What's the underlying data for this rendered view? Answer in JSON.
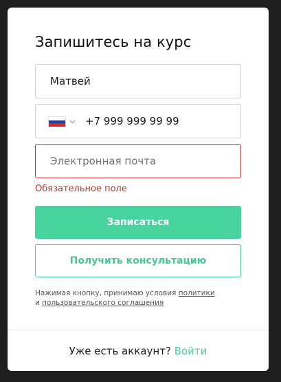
{
  "form": {
    "title": "Запишитесь на курс",
    "name_value": "Матвей",
    "phone": {
      "country_flag": "russia-flag",
      "value": "+7 999 999 99 99"
    },
    "email_placeholder": "Электронная почта",
    "email_error": "Обязательное поле",
    "submit_label": "Записаться",
    "consult_label": "Получить консультацию",
    "consent": {
      "text_before": "Нажимая кнопку, принимаю условия ",
      "policy_link": "политики",
      "conjunction": "и ",
      "agreement_link": "пользовательского соглашения"
    }
  },
  "footer": {
    "question": "Уже есть аккаунт? ",
    "login_link": "Войти"
  },
  "colors": {
    "accent": "#47d39d",
    "error": "#c0392b",
    "card_bg": "#ffffff",
    "page_bg": "#1e1e1e"
  }
}
